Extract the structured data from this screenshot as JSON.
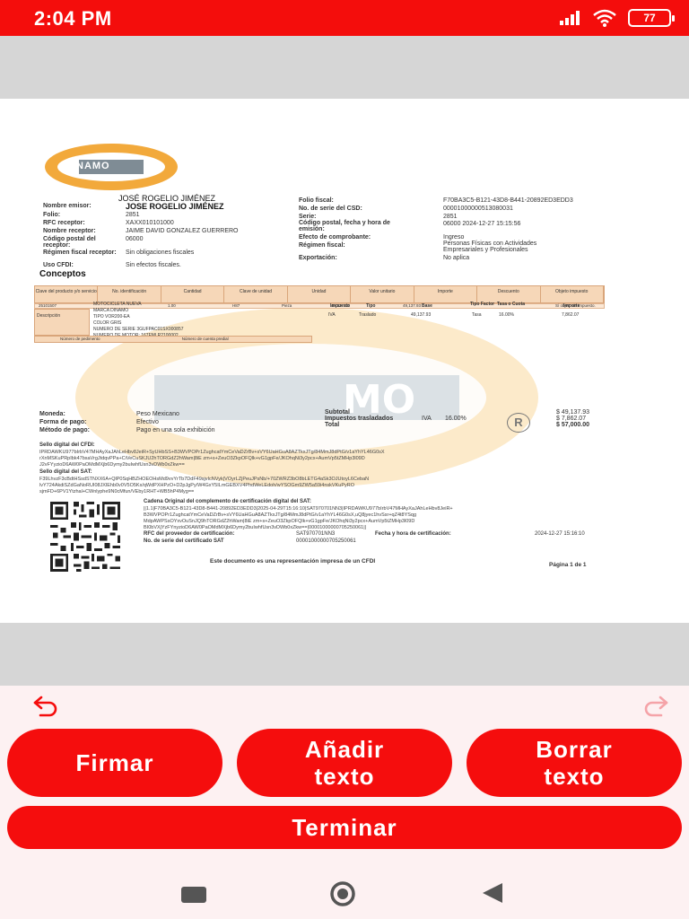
{
  "status_bar": {
    "time": "2:04 PM",
    "battery": "77"
  },
  "document": {
    "logo_text": "DINAMO",
    "emisor_title": "JOSÉ  ROGELIO JIMÉNEZ",
    "left_labels": [
      "Nombre emisor:",
      "Folio:",
      "RFC receptor:",
      "Nombre receptor:",
      "Código postal del receptor:",
      "Régimen fiscal receptor:",
      "Uso CFDI:"
    ],
    "left_values": [
      "JOSE ROGELIO JIMÉNEZ",
      "2851",
      "XAXX010101000",
      "JAIME DAVID GONZALEZ GUERRERO",
      "06000",
      "Sin obligaciones fiscales",
      "Sin efectos fiscales."
    ],
    "right_labels": [
      "Folio fiscal:",
      "No. de serie del CSD:",
      "Serie:",
      "Código postal, fecha y hora de emisión:",
      "Efecto de comprobante:",
      "Régimen fiscal:",
      "Exportación:"
    ],
    "right_values": [
      "F70BA3C5-B121-43D8-B441-20892ED3EDD3",
      "00001000000513080031",
      "2851",
      "06000 2024-12-27 15:15:56",
      "Ingreso",
      "Personas Físicas con Actividades Empresariales y Profesionales",
      "No aplica"
    ],
    "conceptos_title": "Conceptos",
    "table_headers": [
      "Clave del producto y/o servicio",
      "No. identificación",
      "Cantidad",
      "Clave de unidad",
      "Unidad",
      "Valor unitario",
      "Importe",
      "Descuento",
      "Objeto impuesto"
    ],
    "table_row": [
      "25101507",
      "",
      "1.00",
      "H87",
      "Pieza",
      "49,137.93",
      "49,137.93",
      "",
      "Sí objeto de impuesto."
    ],
    "descripcion_label": "Descripción",
    "descripcion_lines": [
      "MOTOCICLETA NUEVA",
      "MARCA DINAMO",
      "TIPO VOR200-EA",
      "COLOR GRIS",
      "NUMERO DE SERIE 3GUFPAC01SX000857",
      "NUMERO DE MOTOR: 167FMLR2100002"
    ],
    "impuesto_headers": [
      "Impuesto",
      "Tipo",
      "Base",
      "Tipo Factor",
      "Tasa o Cuota",
      "Importe"
    ],
    "impuesto_values": [
      "IVA",
      "Traslado",
      "49,137.93",
      "Tasa",
      "16.00%",
      "7,862.07"
    ],
    "pedimento_label": "Número de pedimento",
    "predial_label": "Número de cuenta predial",
    "moneda_label": "Moneda:",
    "moneda_value": "Peso Mexicano",
    "forma_label": "Forma de pago:",
    "forma_value": "Efectivo",
    "metodo_label": "Método de pago:",
    "metodo_value": "Pago en una sola exhibición",
    "subtotal_label": "Subtotal",
    "impuestos_label": "Impuestos trasladados",
    "iva_label": "IVA",
    "iva_rate": "16.00%",
    "total_label": "Total",
    "subtotal_value": "$ 49,137.93",
    "impuestos_value": "$ 7,862.07",
    "total_value": "$ 57,000.00",
    "sello_cfdi_label": "Sello digital del CFDI:",
    "sello_cfdi_1": "IPRDAWKU977bIrbV47MHAyXaJAhLeHbv8JeiR+SyUHbSS+B3WVPOPr1ZughcatYmCeVaDZrBv+sVY6UaHGuA8AZTkxJTg/84MmJ8dPtG/v1aYhYL46G0sX",
    "sello_cfdi_2": "rXnMSKuPRpIbk47bsaVrgJtdqvPPa+CiVeCuSKJU2hTORGdZ2hWam|8iE zm+s+ZeuO3ZkpOFQlk+vG1gpFe/JKOhqNi3y2pcx+AumVp5tZMHp3l09D",
    "sello_cfdi_3": "J2vFYyzioD6AW0PaOMdMXjb6Dymy2buIwhfUsn3vDWb0xZkw==",
    "sello_sat_label": "Sello digital del SAT:",
    "sello_sat_1": "F39LhvzF3cBdtHSsdSTNXX6A+QlP0SqHBZHOEOHsMd9vvYrTb7DdF49sjvIcNVyk|VOyrLZjPeuJPsNb/+70ZWRZ3bO8bLETG4aSk3OJUtoyL6CebaN",
    "sello_sat_2": "lvY724AkdiSZdGaNoRUI08JXlEhb0v0V5O5Kx/qWdPXHPzO+D2pJgPy/W4GxY5ILmGEBXV4PhdWeLEdoh/wYSOGm9ZW5a59i4nskVKuPyRO",
    "sello_sat_3": "sjmFD+6PV1Ytzhal+CWnlyphe9N0cMfun/VEby1RHT+WB5hP4Myg==",
    "cadena_label": "Cadena Original del complemento de certificación digital del SAT:",
    "cadena_1": "||1.1|F70BA3C5-B121-43D8-B441-20892ED3EDD3|2025-04-29T15:16:10|SAT970701NN3|IPRDAWKU977bIrbV47MHAyXaJAhLeHbv8JeiR+",
    "cadena_2": "B3WVPOPr1ZughcatYmCeVaDZrBv+sVY6UaHGuA8AZTkxJTg/84MmJ8dPtG/v1aYhYL46G0sX,uQ8jyec1hvSsr+qZ4t8YSqg",
    "cadena_3": "MdpAWPSsOYxvOuSnJQ9hTORGdZ2hWam|8iE zm+s+ZeuO3ZkpOFQlk+vG1gpFe/JKOhqNi3y2pcx+AumVp5tZMHp3l09D",
    "cadena_4": "BI0bVXjYzFYnyzioD6AW0PaOMdMXjb6Dymy2buIwhfUsn3vDWb0xZkw==|00001000000705250061||",
    "rfc_cert_label": "RFC del proveedor de certificación:",
    "rfc_cert_value": "SAT970701NN3",
    "fecha_cert_label": "Fecha y hora de certificación:",
    "fecha_cert_value": "2024-12-27 15:16:10",
    "serie_cert_label": "No. de serie del certificado SAT",
    "serie_cert_value": "00001000000705250061",
    "footer_text": "Este documento es una representación impresa de un CFDI",
    "page_text": "Página 1 de 1"
  },
  "controls": {
    "undo_icon": "undo-icon",
    "redo_icon": "redo-icon",
    "sign_label": "Firmar",
    "add_text_label": "Añadir\ntexto",
    "delete_text_label": "Borrar\ntexto",
    "finish_label": "Terminar",
    "accent_color": "#f50d0d"
  }
}
